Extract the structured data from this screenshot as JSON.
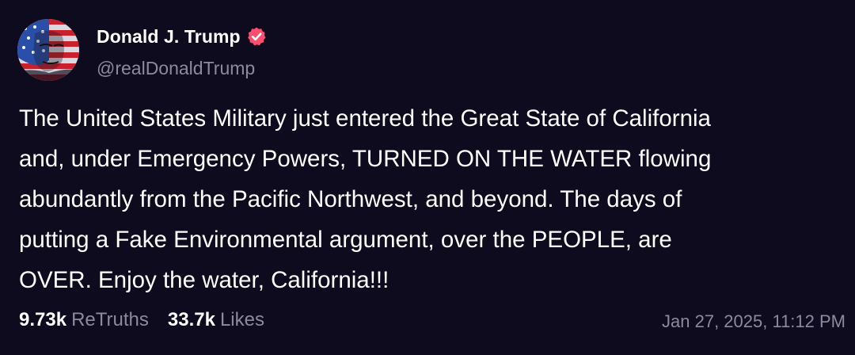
{
  "author": {
    "display_name": "Donald J. Trump",
    "handle": "@realDonaldTrump",
    "verified_icon": "verified-badge-icon",
    "badge_color": "#ff4d6d"
  },
  "post": {
    "text": "The United States Military just entered the Great State of California\nand, under Emergency Powers, TURNED ON THE WATER flowing\nabundantly from the Pacific Northwest, and beyond. The days of\nputting a Fake Environmental argument, over the PEOPLE, are\nOVER. Enjoy the water, California!!!",
    "retruths_count": "9.73k",
    "retruths_label": "ReTruths",
    "likes_count": "33.7k",
    "likes_label": "Likes",
    "timestamp": "Jan 27, 2025, 11:12 PM"
  },
  "colors": {
    "background": "#0e0b1f",
    "text": "#ffffff",
    "muted": "#8e8a9e"
  }
}
